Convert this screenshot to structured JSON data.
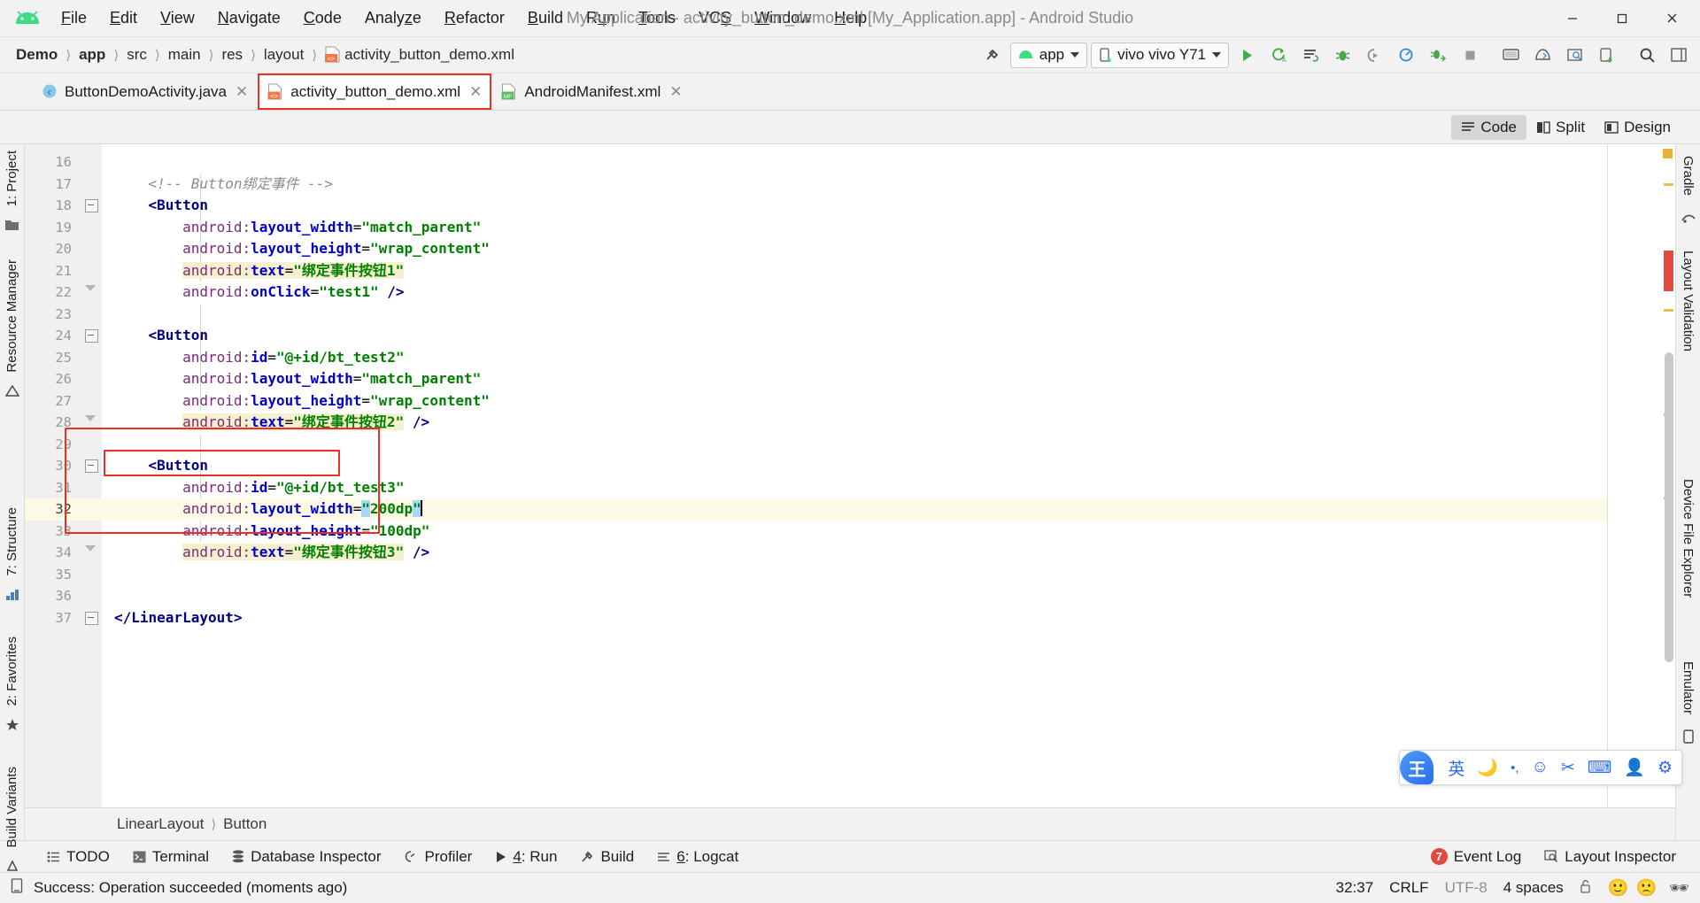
{
  "window": {
    "title": "My Application - activity_button_demo.xml [My_Application.app] - Android Studio",
    "minimize": "—",
    "maximize": "❐",
    "close": "✕"
  },
  "menu": [
    {
      "label": "File"
    },
    {
      "label": "Edit"
    },
    {
      "label": "View"
    },
    {
      "label": "Navigate"
    },
    {
      "label": "Code"
    },
    {
      "label": "Analyze"
    },
    {
      "label": "Refactor"
    },
    {
      "label": "Build"
    },
    {
      "label": "Run"
    },
    {
      "label": "Tools"
    },
    {
      "label": "VCS"
    },
    {
      "label": "Window"
    },
    {
      "label": "Help"
    }
  ],
  "breadcrumbs": [
    "Demo",
    "app",
    "src",
    "main",
    "res",
    "layout",
    "activity_button_demo.xml"
  ],
  "toolbar": {
    "module_selector": "app",
    "device_selector": "vivo vivo Y71",
    "icons": [
      "run-icon",
      "rerun-icon",
      "apply-changes-icon",
      "debug-icon",
      "run-coverage-icon",
      "profiler-icon",
      "attach-debugger-icon",
      "stop-icon",
      "avd-manager-icon",
      "sdk-manager-icon",
      "layout-inspector-icon",
      "device-file-explorer-icon",
      "search-icon",
      "sidebar-toggle-icon"
    ]
  },
  "tabs": [
    {
      "label": "ButtonDemoActivity.java",
      "icon": "java-class-icon",
      "active": false,
      "close": "✕"
    },
    {
      "label": "activity_button_demo.xml",
      "icon": "xml-layout-icon",
      "active": true,
      "close": "✕"
    },
    {
      "label": "AndroidManifest.xml",
      "icon": "manifest-icon",
      "active": false,
      "close": "✕"
    }
  ],
  "editor_modes": [
    {
      "label": "Code",
      "selected": true,
      "icon": "code-mode-icon"
    },
    {
      "label": "Split",
      "selected": false,
      "icon": "split-mode-icon"
    },
    {
      "label": "Design",
      "selected": false,
      "icon": "design-mode-icon"
    }
  ],
  "left_strip": [
    {
      "label": "1: Project",
      "icon": "project-icon"
    },
    {
      "label": "Resource Manager",
      "icon": "resource-manager-icon"
    },
    {
      "label": "7: Structure",
      "icon": "structure-icon"
    },
    {
      "label": "2: Favorites",
      "icon": "favorites-icon"
    },
    {
      "label": "Build Variants",
      "icon": "build-variants-icon"
    }
  ],
  "right_strip": [
    {
      "label": "Gradle",
      "icon": "gradle-icon"
    },
    {
      "label": "Layout Validation",
      "icon": "layout-validation-icon"
    },
    {
      "label": "Device File Explorer",
      "icon": "device-file-explorer-icon"
    },
    {
      "label": "Emulator",
      "icon": "emulator-icon"
    }
  ],
  "editor": {
    "first_line": 16,
    "current_line": 32,
    "lines": [
      {
        "n": 16,
        "html": ""
      },
      {
        "n": 17,
        "html": "<span class=\"cmt\">    &lt;!-- Button绑定事件 --&gt;</span>"
      },
      {
        "n": 18,
        "html": "    <span class=\"tagname\">&lt;Button</span>"
      },
      {
        "n": 19,
        "html": "        <span class=\"attr\">android:</span><span class=\"ns\">layout_width</span><span class=\"eq\">=</span><span class=\"val\">\"match_parent\"</span>"
      },
      {
        "n": 20,
        "html": "        <span class=\"attr\">android:</span><span class=\"ns\">layout_height</span><span class=\"eq\">=</span><span class=\"val\">\"wrap_content\"</span>"
      },
      {
        "n": 21,
        "html": "        <span class=\"hl\"><span class=\"attr\">android:</span><span class=\"ns\">text</span><span class=\"eq\">=</span><span class=\"val\">\"绑定事件按钮1\"</span></span>"
      },
      {
        "n": 22,
        "html": "        <span class=\"attr\">android:</span><span class=\"ns\">onClick</span><span class=\"eq\">=</span><span class=\"val\">\"test1\"</span> <span class=\"tagname\">/&gt;</span>"
      },
      {
        "n": 23,
        "html": ""
      },
      {
        "n": 24,
        "html": "    <span class=\"tagname\">&lt;Button</span>"
      },
      {
        "n": 25,
        "html": "        <span class=\"attr\">android:</span><span class=\"ns\">id</span><span class=\"eq\">=</span><span class=\"val\">\"@+id/bt_test2\"</span>"
      },
      {
        "n": 26,
        "html": "        <span class=\"attr\">android:</span><span class=\"ns\">layout_width</span><span class=\"eq\">=</span><span class=\"val\">\"match_parent\"</span>"
      },
      {
        "n": 27,
        "html": "        <span class=\"attr\">android:</span><span class=\"ns\">layout_height</span><span class=\"eq\">=</span><span class=\"val\">\"wrap_content\"</span>"
      },
      {
        "n": 28,
        "html": "        <span class=\"hl\"><span class=\"attr\">android:</span><span class=\"ns\">text</span><span class=\"eq\">=</span><span class=\"val\">\"绑定事件按钮2\"</span></span> <span class=\"tagname\">/&gt;</span>"
      },
      {
        "n": 29,
        "html": ""
      },
      {
        "n": 30,
        "html": "    <span class=\"tagname\">&lt;Button</span>"
      },
      {
        "n": 31,
        "html": "        <span class=\"attr\">android:</span><span class=\"ns\">id</span><span class=\"eq\">=</span><span class=\"val\">\"@+id/bt_test3\"</span>"
      },
      {
        "n": 32,
        "html": "        <span class=\"attr\">android:</span><span class=\"ns\">layout_width</span><span class=\"eq\">=</span><span class=\"selq val\">\"</span><span class=\"val\">200dp</span><span class=\"selq val\">\"</span><span class=\"caretbar\"></span>"
      },
      {
        "n": 33,
        "html": "        <span class=\"attr\">android:</span><span class=\"ns\">layout_height</span><span class=\"eq\">=</span><span class=\"val\">\"100dp\"</span>"
      },
      {
        "n": 34,
        "html": "        <span class=\"hl\"><span class=\"attr\">android:</span><span class=\"ns\">text</span><span class=\"eq\">=</span><span class=\"val\">\"绑定事件按钮3\"</span></span> <span class=\"tagname\">/&gt;</span>"
      },
      {
        "n": 35,
        "html": ""
      },
      {
        "n": 36,
        "html": ""
      },
      {
        "n": 37,
        "html": "<span class=\"tagname\">&lt;/LinearLayout&gt;</span>"
      }
    ]
  },
  "code_breadcrumb": [
    "LinearLayout",
    "Button"
  ],
  "tool_windows": [
    {
      "label": "TODO",
      "icon": "todo-icon",
      "mnemonic": ""
    },
    {
      "label": "Terminal",
      "icon": "terminal-icon",
      "mnemonic": ""
    },
    {
      "label": "Database Inspector",
      "icon": "database-icon",
      "mnemonic": ""
    },
    {
      "label": "Profiler",
      "icon": "profiler-icon",
      "mnemonic": ""
    },
    {
      "label": "Run",
      "icon": "run-icon",
      "mnemonic": "4"
    },
    {
      "label": "Build",
      "icon": "build-icon",
      "mnemonic": ""
    },
    {
      "label": "Logcat",
      "icon": "logcat-icon",
      "mnemonic": "6"
    }
  ],
  "tool_windows_right": [
    {
      "label": "Event Log",
      "icon": "event-log-icon",
      "badge": "7"
    },
    {
      "label": "Layout Inspector",
      "icon": "layout-inspector-icon",
      "badge": ""
    }
  ],
  "status": {
    "icon": "status-info-icon",
    "message": "Success: Operation succeeded (moments ago)",
    "caret_position": "32:37",
    "line_separator": "CRLF",
    "encoding": "UTF-8",
    "indent": "4 spaces",
    "lock_icon": "unlocked-icon"
  },
  "ime": {
    "logo": "王",
    "mode": "英",
    "items": [
      "moon-icon",
      "punctuation-icon",
      "emoji-icon",
      "scissors-icon",
      "keyboard-icon",
      "user-icon",
      "gear-icon"
    ]
  },
  "colors": {
    "accent_red": "#ee2d23",
    "android_green": "#3ddc84",
    "tag_blue": "#000080",
    "value_green": "#008000",
    "attr_purple": "#7a2a7a",
    "highlight_yellow": "#f7f0cf",
    "current_line": "#fcf9e7"
  }
}
